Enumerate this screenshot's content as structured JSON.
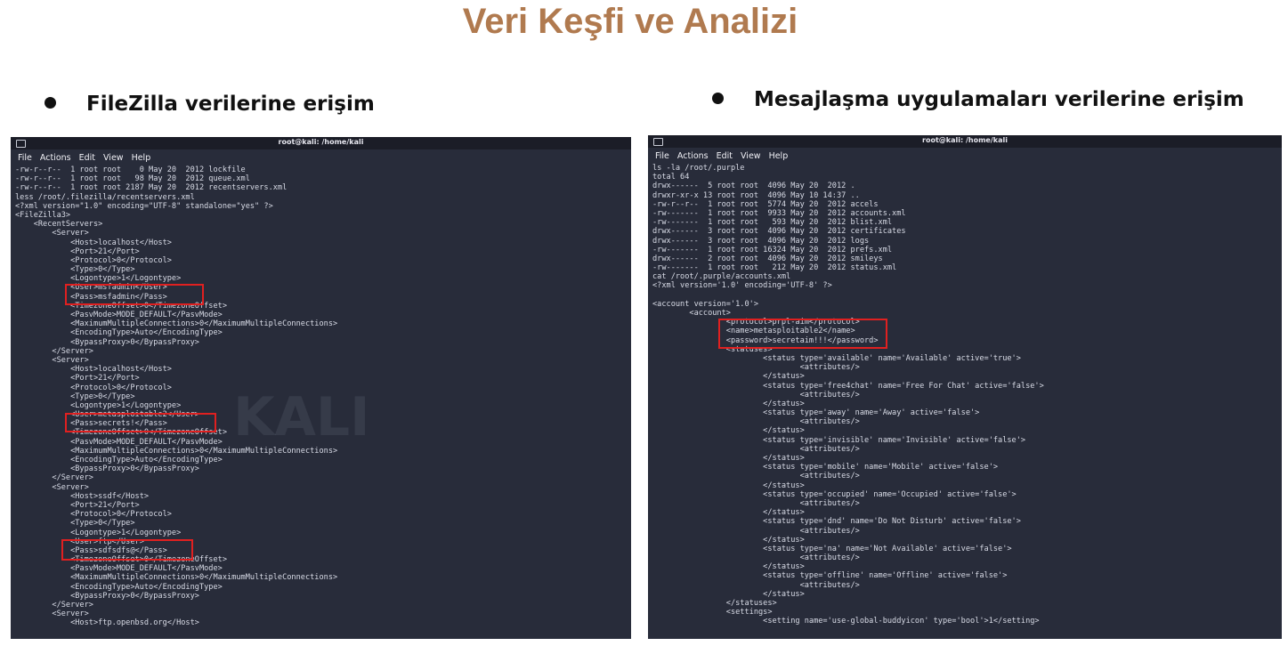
{
  "slide_title": "Veri Keşfi ve Analizi",
  "bullets": [
    "FileZilla verilerine erişim",
    "Mesajlaşma uygulamaları verilerine erişim"
  ],
  "terminals": [
    {
      "window_title": "root@kali: /home/kali",
      "menu": [
        "File",
        "Actions",
        "Edit",
        "View",
        "Help"
      ],
      "watermark": "KALI",
      "lines": [
        "-rw-r--r--  1 root root    0 May 20  2012 lockfile",
        "-rw-r--r--  1 root root   98 May 20  2012 queue.xml",
        "-rw-r--r--  1 root root 2187 May 20  2012 recentservers.xml",
        "less /root/.filezilla/recentservers.xml",
        "<?xml version=\"1.0\" encoding=\"UTF-8\" standalone=\"yes\" ?>",
        "<FileZilla3>",
        "    <RecentServers>",
        "        <Server>",
        "            <Host>localhost</Host>",
        "            <Port>21</Port>",
        "            <Protocol>0</Protocol>",
        "            <Type>0</Type>",
        "            <Logontype>1</Logontype>",
        "            <User>msfadmin</User>",
        "            <Pass>msfadmin</Pass>",
        "            <TimezoneOffset>0</TimezoneOffset>",
        "            <PasvMode>MODE_DEFAULT</PasvMode>",
        "            <MaximumMultipleConnections>0</MaximumMultipleConnections>",
        "            <EncodingType>Auto</EncodingType>",
        "            <BypassProxy>0</BypassProxy>",
        "        </Server>",
        "        <Server>",
        "            <Host>localhost</Host>",
        "            <Port>21</Port>",
        "            <Protocol>0</Protocol>",
        "            <Type>0</Type>",
        "            <Logontype>1</Logontype>",
        "            <User>metasploitable2</User>",
        "            <Pass>secrets!</Pass>",
        "            <TimezoneOffset>0</TimezoneOffset>",
        "            <PasvMode>MODE_DEFAULT</PasvMode>",
        "            <MaximumMultipleConnections>0</MaximumMultipleConnections>",
        "            <EncodingType>Auto</EncodingType>",
        "            <BypassProxy>0</BypassProxy>",
        "        </Server>",
        "        <Server>",
        "            <Host>ssdf</Host>",
        "            <Port>21</Port>",
        "            <Protocol>0</Protocol>",
        "            <Type>0</Type>",
        "            <Logontype>1</Logontype>",
        "            <User>ftp</User>",
        "            <Pass>sdfsdfs@</Pass>",
        "            <TimezoneOffset>0</TimezoneOffset>",
        "            <PasvMode>MODE_DEFAULT</PasvMode>",
        "            <MaximumMultipleConnections>0</MaximumMultipleConnections>",
        "            <EncodingType>Auto</EncodingType>",
        "            <BypassProxy>0</BypassProxy>",
        "        </Server>",
        "        <Server>",
        "            <Host>ftp.openbsd.org</Host>"
      ]
    },
    {
      "window_title": "root@kali: /home/kali",
      "menu": [
        "File",
        "Actions",
        "Edit",
        "View",
        "Help"
      ],
      "lines": [
        "ls -la /root/.purple",
        "total 64",
        "drwx------  5 root root  4096 May 20  2012 .",
        "drwxr-xr-x 13 root root  4096 May 10 14:37 ..",
        "-rw-r--r--  1 root root  5774 May 20  2012 accels",
        "-rw-------  1 root root  9933 May 20  2012 accounts.xml",
        "-rw-------  1 root root   593 May 20  2012 blist.xml",
        "drwx------  3 root root  4096 May 20  2012 certificates",
        "drwx------  3 root root  4096 May 20  2012 logs",
        "-rw-------  1 root root 16324 May 20  2012 prefs.xml",
        "drwx------  2 root root  4096 May 20  2012 smileys",
        "-rw-------  1 root root   212 May 20  2012 status.xml",
        "cat /root/.purple/accounts.xml",
        "<?xml version='1.0' encoding='UTF-8' ?>",
        "",
        "<account version='1.0'>",
        "        <account>",
        "                <protocol>prpl-aim</protocol>",
        "                <name>metasploitable2</name>",
        "                <password>secretaim!!!</password>",
        "                <statuses>",
        "                        <status type='available' name='Available' active='true'>",
        "                                <attributes/>",
        "                        </status>",
        "                        <status type='free4chat' name='Free For Chat' active='false'>",
        "                                <attributes/>",
        "                        </status>",
        "                        <status type='away' name='Away' active='false'>",
        "                                <attributes/>",
        "                        </status>",
        "                        <status type='invisible' name='Invisible' active='false'>",
        "                                <attributes/>",
        "                        </status>",
        "                        <status type='mobile' name='Mobile' active='false'>",
        "                                <attributes/>",
        "                        </status>",
        "                        <status type='occupied' name='Occupied' active='false'>",
        "                                <attributes/>",
        "                        </status>",
        "                        <status type='dnd' name='Do Not Disturb' active='false'>",
        "                                <attributes/>",
        "                        </status>",
        "                        <status type='na' name='Not Available' active='false'>",
        "                                <attributes/>",
        "                        </status>",
        "                        <status type='offline' name='Offline' active='false'>",
        "                                <attributes/>",
        "                        </status>",
        "                </statuses>",
        "                <settings>",
        "                        <setting name='use-global-buddyicon' type='bool'>1</setting>"
      ]
    }
  ],
  "colors": {
    "title": "#b07a4f",
    "terminal_bg": "#282c3a",
    "highlight": "#e02020"
  }
}
